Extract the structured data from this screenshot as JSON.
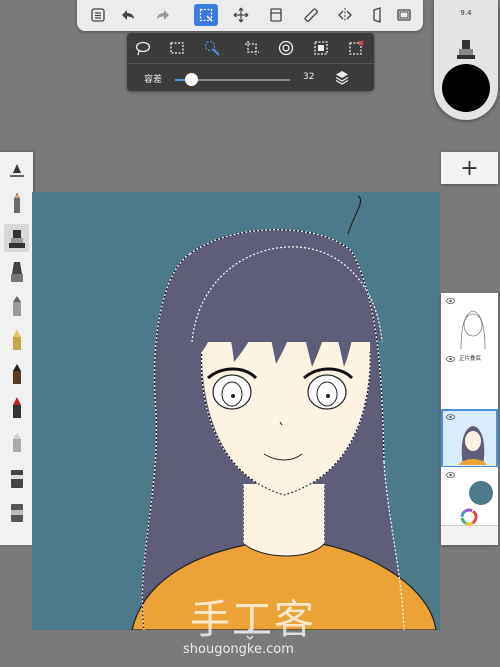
{
  "app": "Autodesk SketchBook",
  "top_toolbar": {
    "items": [
      "menu-icon",
      "undo-icon",
      "redo-icon",
      "selection-icon",
      "transform-icon",
      "layer-stack-icon",
      "ruler-icon",
      "symmetry-icon",
      "perspective-icon",
      "fullscreen-icon"
    ],
    "active": "selection-icon"
  },
  "selection_bar": {
    "tools": [
      "lasso-select-icon",
      "rect-select-icon",
      "magic-wand-icon",
      "crop-icon",
      "target-icon",
      "invert-select-icon",
      "clear-select-icon"
    ],
    "active_tool": "magic-wand-icon",
    "tolerance_label": "容差",
    "tolerance_value": "32",
    "tolerance_fraction": 0.14
  },
  "puck": {
    "brush_size": "9.4",
    "color": "#000000"
  },
  "brush_palette": {
    "brushes": [
      "ruler-brush",
      "pencil-brush",
      "airbrush-brush",
      "marker-brush",
      "chisel-brush",
      "pen-brush",
      "ink-pen-brush",
      "felt-tip-brush",
      "smudge-brush",
      "eraser-brush",
      "soft-eraser-brush"
    ],
    "active": "airbrush-brush"
  },
  "layers": {
    "add_label": "+",
    "items": [
      {
        "name": "",
        "visible": true,
        "selected": false,
        "thumb": "line-art"
      },
      {
        "name": "正片叠底",
        "visible": true,
        "selected": false,
        "thumb": "blank"
      },
      {
        "name": "",
        "visible": true,
        "selected": true,
        "thumb": "girl"
      },
      {
        "name": "",
        "visible": true,
        "selected": false,
        "thumb": "background"
      }
    ]
  },
  "canvas": {
    "background_color": "#4e7b8c",
    "hair_color": "#5f5e7a",
    "skin_color": "#fdf3e2",
    "shirt_color": "#eba338"
  },
  "watermark": {
    "title": "手工客",
    "url": "shougongke.com"
  }
}
